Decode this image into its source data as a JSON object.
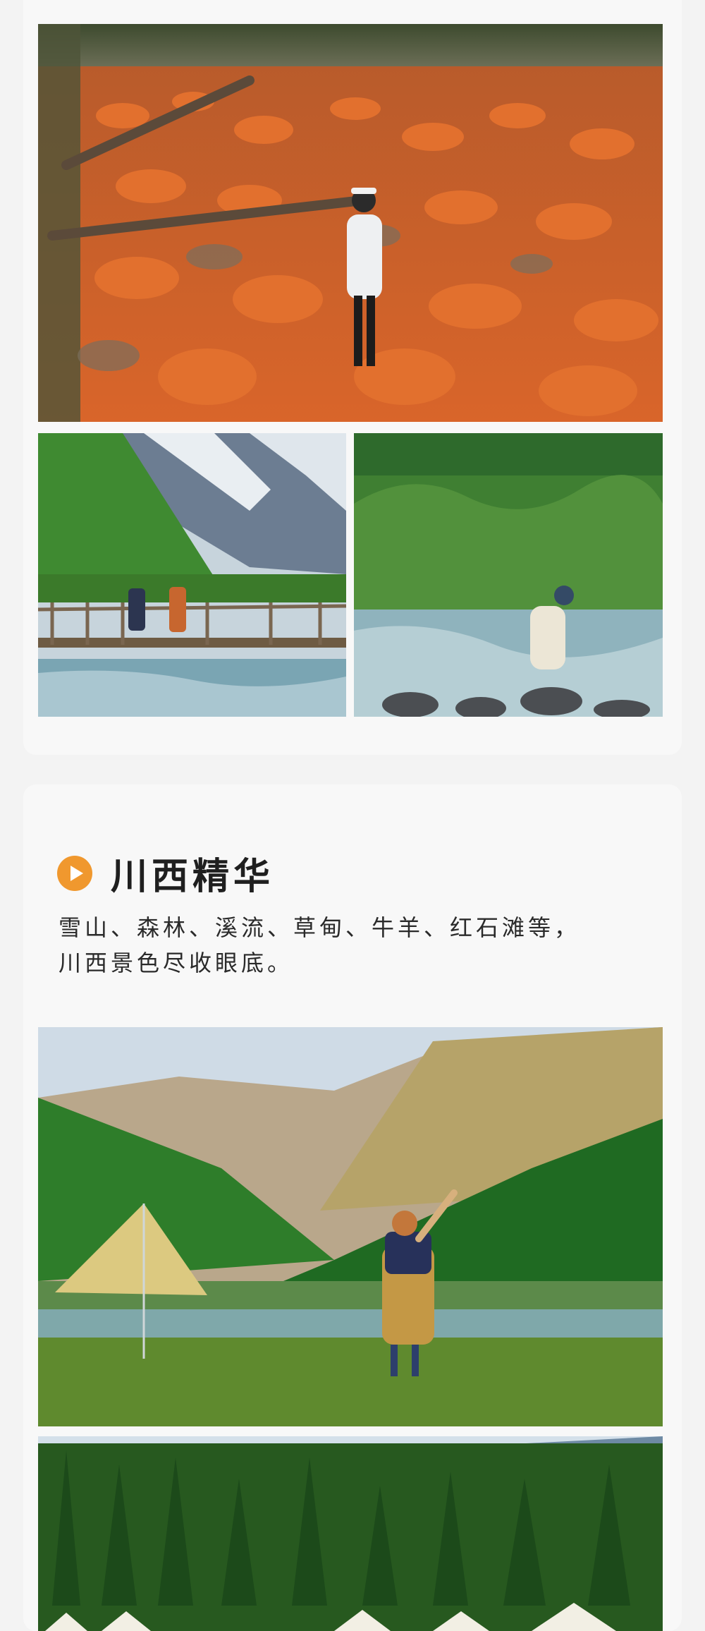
{
  "section": {
    "title": "川西精华",
    "desc_line1": "雪山、森林、溪流、草甸、牛羊、红石滩等，",
    "desc_line2": "川西景色尽收眼底。"
  },
  "icons": {
    "section_marker": "play-circle-icon"
  },
  "colors": {
    "accent": "#f0982e",
    "card_background": "#f8f8f8",
    "page_background": "#f3f3f3"
  }
}
